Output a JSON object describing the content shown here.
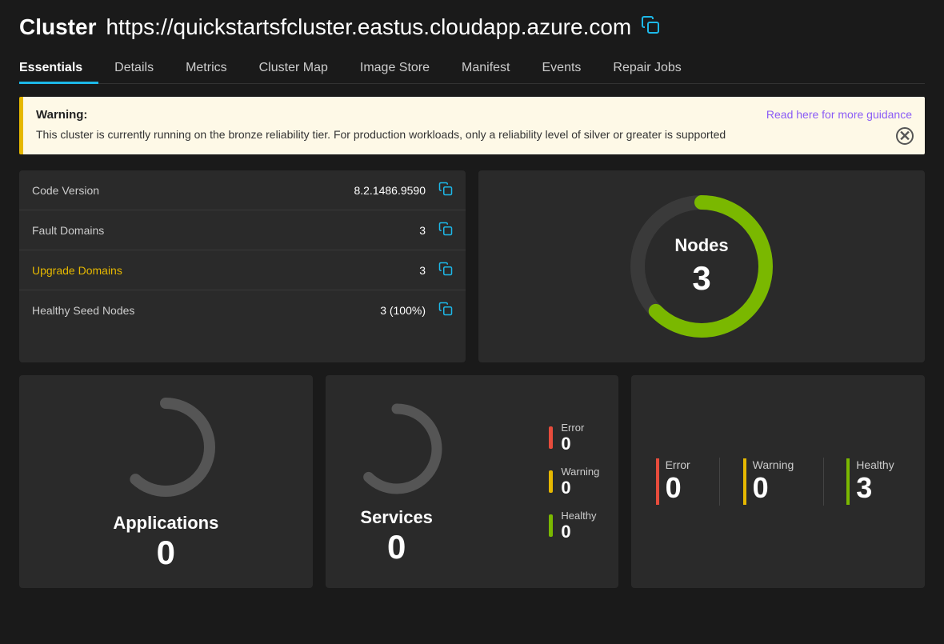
{
  "header": {
    "cluster_label": "Cluster",
    "cluster_url": "https://quickstartsfcluster.eastus.cloudapp.azure.com",
    "copy_icon": "⧉"
  },
  "nav": {
    "tabs": [
      {
        "id": "essentials",
        "label": "Essentials",
        "active": true
      },
      {
        "id": "details",
        "label": "Details",
        "active": false
      },
      {
        "id": "metrics",
        "label": "Metrics",
        "active": false
      },
      {
        "id": "cluster-map",
        "label": "Cluster Map",
        "active": false
      },
      {
        "id": "image-store",
        "label": "Image Store",
        "active": false
      },
      {
        "id": "manifest",
        "label": "Manifest",
        "active": false
      },
      {
        "id": "events",
        "label": "Events",
        "active": false
      },
      {
        "id": "repair-jobs",
        "label": "Repair Jobs",
        "active": false
      }
    ]
  },
  "warning": {
    "label": "Warning:",
    "text": "This cluster is currently running on the bronze reliability tier. For production workloads, only a reliability level of silver or greater is supported",
    "link_text": "Read here for more guidance",
    "close_icon": "×"
  },
  "info_rows": [
    {
      "id": "code-version",
      "label": "Code Version",
      "value": "8.2.1486.9590",
      "warning": false
    },
    {
      "id": "fault-domains",
      "label": "Fault Domains",
      "value": "3",
      "warning": false
    },
    {
      "id": "upgrade-domains",
      "label": "Upgrade Domains",
      "value": "3",
      "warning": true
    },
    {
      "id": "healthy-seed-nodes",
      "label": "Healthy Seed Nodes",
      "value": "3 (100%)",
      "warning": false
    }
  ],
  "nodes": {
    "label": "Nodes",
    "count": "3",
    "donut_color": "#7ab800",
    "donut_bg": "#3a3a3a"
  },
  "applications": {
    "label": "Applications",
    "count": "0"
  },
  "services": {
    "label": "Services",
    "count": "0",
    "stats": [
      {
        "id": "error",
        "name": "Error",
        "value": "0",
        "color": "#e74c3c",
        "type": "error"
      },
      {
        "id": "warning",
        "name": "Warning",
        "value": "0",
        "color": "#e6b800",
        "type": "warning"
      },
      {
        "id": "healthy",
        "name": "Healthy",
        "value": "0",
        "color": "#7ab800",
        "type": "healthy"
      }
    ]
  },
  "nodes_stats": {
    "error": {
      "label": "Error",
      "value": "0"
    },
    "warning": {
      "label": "Warning",
      "value": "0"
    },
    "healthy": {
      "label": "Healthy",
      "value": "3"
    }
  }
}
